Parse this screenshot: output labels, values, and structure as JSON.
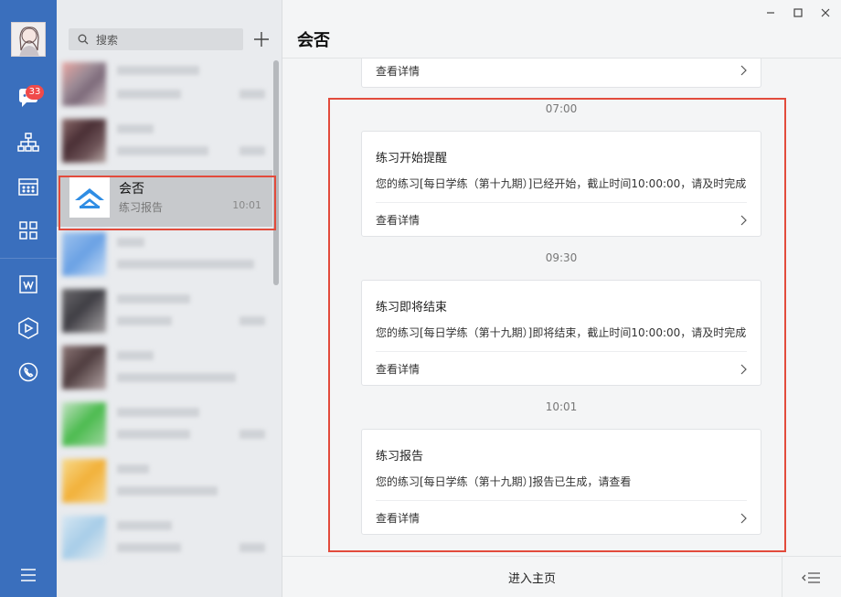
{
  "rail": {
    "badge_count": "33",
    "icons": [
      "chat-icon",
      "org-chart-icon",
      "calendar-icon",
      "apps-grid-icon",
      "w-app-icon",
      "hexagon-app-icon",
      "phone-icon",
      "menu-icon"
    ],
    "accent": "#3a6fbd",
    "badge_color": "#f04a4a"
  },
  "list": {
    "search_placeholder": "搜索",
    "active_conversation": {
      "title": "会否",
      "subtitle": "练习报告",
      "time": "10:01"
    }
  },
  "chat": {
    "title": "会否",
    "top_card_link": "查看详情",
    "messages": [
      {
        "time": "07:00",
        "title": "练习开始提醒",
        "text": "您的练习[每日学练（第十九期）]已经开始，截止时间10:00:00，请及时完成",
        "link": "查看详情"
      },
      {
        "time": "09:30",
        "title": "练习即将结束",
        "text": "您的练习[每日学练（第十九期）]即将结束，截止时间10:00:00，请及时完成",
        "link": "查看详情"
      },
      {
        "time": "10:01",
        "title": "练习报告",
        "text": "您的练习[每日学练（第十九期）]报告已生成，请查看",
        "link": "查看详情"
      }
    ],
    "footer_button": "进入主页",
    "highlight_color": "#e24b3c"
  }
}
